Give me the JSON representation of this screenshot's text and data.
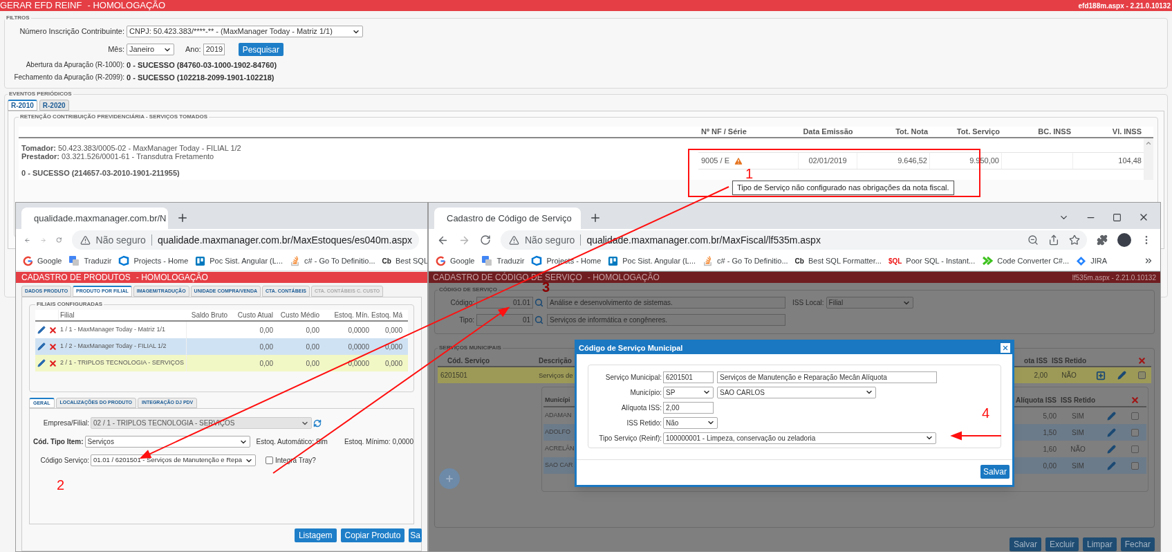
{
  "main": {
    "title": "GERAR EFD REINF",
    "env": "- HOMOLOGAÇÃO",
    "version": "efd188m.aspx - 2.21.0.10132",
    "filters": {
      "legend": "FILTROS",
      "contribuinte_label": "Número Inscrição Contribuinte:",
      "contribuinte_value": "CNPJ: 50.423.383/****-** - (MaxManager Today - Matriz 1/1)",
      "mes_label": "Mês:",
      "mes_value": "Janeiro",
      "ano_label": "Ano:",
      "ano_value": "2019",
      "search_button": "Pesquisar",
      "abertura_label": "Abertura da Apuração (R-1000):",
      "abertura_value": "0 - SUCESSO (84760-03-1000-1902-84760)",
      "fechamento_label": "Fechamento da Apuração (R-2099):",
      "fechamento_value": "0 - SUCESSO (102218-2099-1901-102218)"
    },
    "events": {
      "legend": "EVENTOS PERIÓDICOS",
      "tabs": [
        {
          "label": "R-2010",
          "selected": true
        },
        {
          "label": "R-2020",
          "selected": false
        }
      ],
      "section": "RETENÇÃO CONTRIBUIÇÃO PREVIDENCIÁRIA - SERVIÇOS TOMADOS",
      "tomador": "**Tomador:** 50.423.383/0005-02 - MaxManager Today - FILIAL 1/2",
      "prestador": "**Prestador:** 03.321.526/0001-61 - Transdutra Fretamento",
      "status": "0 - SUCESSO (214657-03-2010-1901-211955)",
      "columns": [
        "Nº NF / Série",
        "Data Emissão",
        "Tot. Nota",
        "Tot. Serviço",
        "BC. INSS",
        "Vl. INSS"
      ],
      "row": {
        "nf": "9005 / E",
        "warning": true,
        "data": "02/01/2019",
        "tot_nota": "9.646,52",
        "tot_servico": "9.950,00",
        "vl_inss": "104,48"
      },
      "tooltip": "Tipo de Serviço não configurado nas obrigações da nota fiscal."
    }
  },
  "left_window": {
    "tab_title": "qualidade.maxmanager.com.br/N",
    "insecure": "Não seguro",
    "url": "qualidade.maxmanager.com.br/MaxEstoques/es040m.aspx",
    "bookmarks": [
      {
        "label": "Google",
        "kind": "google"
      },
      {
        "label": "Traduzir",
        "kind": "translate"
      },
      {
        "label": "Projects - Home",
        "kind": "devops"
      },
      {
        "label": "Poc Sist. Angular (L...",
        "kind": "board"
      },
      {
        "label": "c# - Go To Definitio...",
        "kind": "stack"
      },
      {
        "label": "Best SQL",
        "kind": "text",
        "badge": "Cb"
      }
    ],
    "title": "CADASTRO DE PRODUTOS",
    "env": "- HOMOLOGAÇÃO",
    "tabs": [
      {
        "label": "DADOS PRODUTO",
        "selected": false,
        "disabled": false
      },
      {
        "label": "PRODUTO POR FILIAL",
        "selected": true,
        "disabled": false
      },
      {
        "label": "IMAGEM/TRADUÇÃO",
        "selected": false,
        "disabled": false
      },
      {
        "label": "UNIDADE COMPRA/VENDA",
        "selected": false,
        "disabled": false
      },
      {
        "label": "CTA. CONTÁBEIS",
        "selected": false,
        "disabled": false
      },
      {
        "label": "CTA. CONTÁBEIS C. CUSTO",
        "selected": false,
        "disabled": true
      }
    ],
    "filiais": {
      "legend": "FILIAIS CONFIGURADAS",
      "columns": [
        "Filial",
        "Saldo Bruto",
        "Custo Atual",
        "Custo Médio",
        "Estoq. Mín.",
        "Estoq. Má"
      ],
      "rows": [
        {
          "filial": "1 / 1 - MaxManager Today - Matriz 1/1",
          "values": [
            "0,00",
            "0,00",
            "0,0000",
            "0,000"
          ],
          "selected": false
        },
        {
          "filial": "1 / 2 - MaxManager Today - FILIAL 1/2",
          "values": [
            "0,00",
            "0,00",
            "0,0000",
            "0,000"
          ],
          "selected": false
        },
        {
          "filial": "2 / 1 - TRIPLOS TECNOLOGIA - SERVIÇOS",
          "values": [
            "0,00",
            "0,00",
            "0,0000",
            "0,000"
          ],
          "selected": true
        }
      ]
    },
    "subtabs": [
      {
        "label": "GERAL",
        "selected": true
      },
      {
        "label": "LOCALIZAÇÕES DO PRODUTO",
        "selected": false
      },
      {
        "label": "INTEGRAÇÃO DJ PDV",
        "selected": false
      }
    ],
    "form": {
      "empresa_label": "Empresa/Filial:",
      "empresa_value": "02 / 1 - TRIPLOS TECNOLOGIA - SERVIÇOS",
      "empresa_disabled": true,
      "tipo_label": "Cód. Tipo Item:",
      "tipo_value": "Serviços",
      "auto_label": "Estoq. Automático: Sim",
      "minimo_label": "Estoq. Mínimo: 0,0000",
      "codigo_label": "Código Serviço:",
      "codigo_value": "01.01 / 6201501 - Serviços de Manutenção e Repa",
      "tray_label": "Integra Tray?",
      "tray_checked": false
    },
    "buttons": [
      "Listagem",
      "Copiar Produto",
      "Sa"
    ]
  },
  "right_window": {
    "tab_title": "Cadastro de Código de Serviço",
    "insecure": "Não seguro",
    "url": "qualidade.maxmanager.com.br/MaxFiscal/lf535m.aspx",
    "bookmarks": [
      {
        "label": "Google",
        "kind": "google"
      },
      {
        "label": "Traduzir",
        "kind": "translate"
      },
      {
        "label": "Projects - Home",
        "kind": "devops"
      },
      {
        "label": "Poc Sist. Angular (L...",
        "kind": "board"
      },
      {
        "label": "c# - Go To Definitio...",
        "kind": "stack"
      },
      {
        "label": "Best SQL Formatter...",
        "kind": "text",
        "badge": "Cb"
      },
      {
        "label": "Poor SQL - Instant...",
        "kind": "text",
        "badge": "$QL"
      },
      {
        "label": "Code Converter C#...",
        "kind": "code"
      },
      {
        "label": "JIRA",
        "kind": "jira"
      }
    ],
    "title": "CADASTRO DE CÓDIGO DE SERVIÇO",
    "env": "- HOMOLOGAÇÃO",
    "version": "lf535m.aspx - 2.21.0.10132",
    "codigo": {
      "legend": "CÓDIGO DE SERVIÇO",
      "codigo_label": "Código:",
      "codigo_value": "01.01",
      "codigo_desc": "Análise e desenvolvimento de sistemas.",
      "iss_label": "ISS Local:",
      "iss_value": "Filial",
      "tipo_label": "Tipo:",
      "tipo_value": "01",
      "tipo_desc": "Serviços de informática e congêneres."
    },
    "servicos": {
      "legend": "SERVIÇOS MUNICIPAIS",
      "columns": [
        "Cód. Serviço",
        "Descrição",
        "ota ISS",
        "ISS Retido"
      ],
      "row": {
        "code": "6201501",
        "desc": "Serviços de",
        "aliquota": "2,00",
        "retido": "NÃO",
        "selected": true,
        "checked": false
      },
      "sub_columns": [
        "Municípi",
        "Alíquota ISS",
        "ISS Retido"
      ],
      "sub_rows": [
        {
          "municipio": "ADAMAN",
          "aliquota": "5,00",
          "retido": "SIM",
          "checked": false
        },
        {
          "municipio": "ADOLFO",
          "aliquota": "1,50",
          "retido": "SIM",
          "checked": false
        },
        {
          "municipio": "ACRELÂN",
          "aliquota": "1,60",
          "retido": "NÃO",
          "checked": false
        },
        {
          "municipio": "SAO CAR",
          "aliquota": "0,00",
          "retido": "SIM",
          "checked": false
        }
      ]
    },
    "buttons": [
      "Salvar",
      "Excluir",
      "Limpar",
      "Fechar"
    ]
  },
  "modal": {
    "title": "Código de Serviço Municipal",
    "servico_label": "Serviço Municipal:",
    "servico_code": "6201501",
    "servico_desc": "Serviços de Manutenção e Reparação Mecân Alíquota",
    "municipio_label": "Município:",
    "uf": "SP",
    "cidade": "SAO CARLOS",
    "aliquota_label": "Alíquota ISS:",
    "aliquota": "2,00",
    "retido_label": "ISS Retido:",
    "retido": "Não",
    "tipo_label": "Tipo Serviço (Reinf):",
    "tipo": "100000001 - Limpeza, conservação ou zeladoria",
    "save": "Salvar"
  },
  "annotations": [
    {
      "label": "1"
    },
    {
      "label": "2"
    },
    {
      "label": "3"
    },
    {
      "label": "4"
    }
  ]
}
